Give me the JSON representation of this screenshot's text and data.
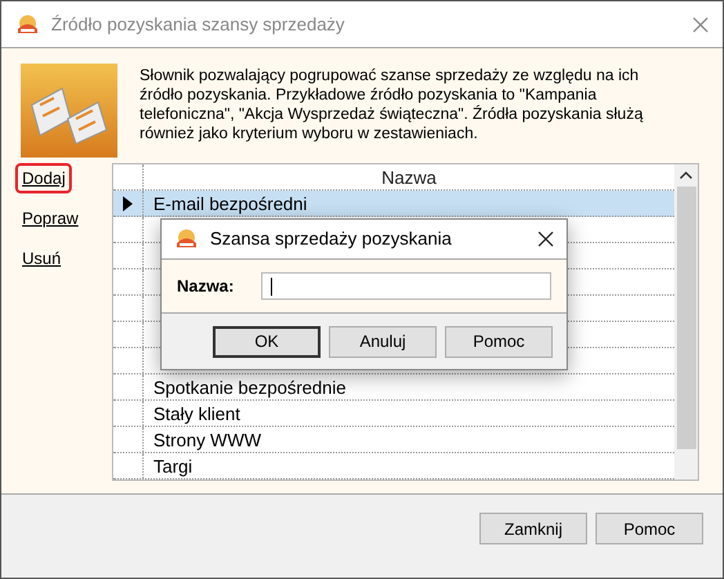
{
  "window": {
    "title": "Źródło pozyskania szansy sprzedaży",
    "description": "Słownik pozwalający pogrupować szanse sprzedaży ze względu na ich źródło pozyskania. Przykładowe źródło pozyskania to \"Kampania telefoniczna\", \"Akcja Wysprzedaż świąteczna\". Źródła pozyskania służą również jako kryterium wyboru w zestawieniach."
  },
  "actions": [
    {
      "label": "Dodaj",
      "highlighted": true
    },
    {
      "label": "Popraw",
      "highlighted": false
    },
    {
      "label": "Usuń",
      "highlighted": false
    }
  ],
  "table": {
    "columns": [
      "Nazwa"
    ],
    "rows": [
      {
        "name": "E-mail bezpośredni",
        "selected": true
      },
      {
        "name": "",
        "selected": false
      },
      {
        "name": "",
        "selected": false
      },
      {
        "name": "",
        "selected": false
      },
      {
        "name": "",
        "selected": false
      },
      {
        "name": "",
        "selected": false
      },
      {
        "name": "",
        "selected": false
      },
      {
        "name": "Spotkanie bezpośrednie",
        "selected": false
      },
      {
        "name": "Stały klient",
        "selected": false
      },
      {
        "name": "Strony WWW",
        "selected": false
      },
      {
        "name": "Targi",
        "selected": false
      }
    ]
  },
  "buttons": [
    "Zamknij",
    "Pomoc"
  ],
  "dialog": {
    "title": "Szansa sprzedaży pozyskania",
    "field_label": "Nazwa:",
    "buttons": [
      {
        "label": "OK",
        "default": true
      },
      {
        "label": "Anuluj",
        "default": false
      },
      {
        "label": "Pomoc",
        "default": false
      }
    ]
  }
}
